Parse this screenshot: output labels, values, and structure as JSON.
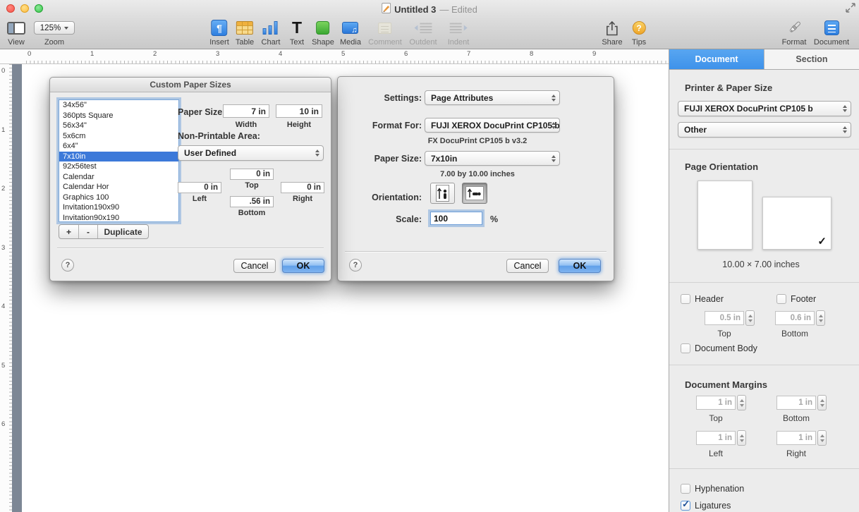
{
  "icons": {
    "check": "✓",
    "question": "?",
    "pilcrow": "¶",
    "music": "♫",
    "text_t": "T"
  },
  "window": {
    "title": "Untitled 3",
    "edited": "— Edited"
  },
  "toolbar": {
    "view": {
      "label": "View"
    },
    "zoom": {
      "label": "Zoom",
      "value": "125%"
    },
    "insert": {
      "label": "Insert"
    },
    "table": {
      "label": "Table"
    },
    "chart": {
      "label": "Chart"
    },
    "text": {
      "label": "Text"
    },
    "shape": {
      "label": "Shape"
    },
    "media": {
      "label": "Media"
    },
    "comment": {
      "label": "Comment"
    },
    "outdent": {
      "label": "Outdent"
    },
    "indent": {
      "label": "Indent"
    },
    "share": {
      "label": "Share"
    },
    "tips": {
      "label": "Tips"
    },
    "format": {
      "label": "Format"
    },
    "document": {
      "label": "Document"
    }
  },
  "ruler": {
    "horizontal": [
      "0",
      "1",
      "2",
      "3",
      "4",
      "5",
      "6",
      "7",
      "8",
      "9"
    ],
    "vertical": [
      "0",
      "1",
      "2",
      "3",
      "4",
      "5",
      "6"
    ]
  },
  "custom_paper_dialog": {
    "title": "Custom Paper Sizes",
    "sizes": [
      "34x56\"",
      "360pts Square",
      "56x34\"",
      "5x6cm",
      "6x4\"",
      "7x10in",
      "92x56test",
      "Calendar",
      "Calendar Hor",
      "Graphics 100",
      "Invitation190x90",
      "Invitation90x190"
    ],
    "selected": "7x10in",
    "paper_size_label": "Paper Size:",
    "width": {
      "value": "7 in",
      "label": "Width"
    },
    "height": {
      "value": "10 in",
      "label": "Height"
    },
    "nonprintable_label": "Non-Printable Area:",
    "nonprintable_value": "User Defined",
    "margin_top": {
      "value": "0 in",
      "label": "Top"
    },
    "margin_left": {
      "value": "0 in",
      "label": "Left"
    },
    "margin_right": {
      "value": "0 in",
      "label": "Right"
    },
    "margin_bottom": {
      "value": ".56 in",
      "label": "Bottom"
    },
    "add_label": "+",
    "remove_label": "-",
    "duplicate_label": "Duplicate",
    "help_label": "?",
    "cancel_label": "Cancel",
    "ok_label": "OK"
  },
  "page_setup_dialog": {
    "settings_label": "Settings:",
    "settings_value": "Page Attributes",
    "format_label": "Format For:",
    "format_value": "FUJI XEROX DocuPrint CP105 b",
    "format_sub": "FX DocuPrint CP105 b v3.2",
    "paper_label": "Paper Size:",
    "paper_value": "7x10in",
    "paper_sub": "7.00 by 10.00 inches",
    "orientation_label": "Orientation:",
    "scale_label": "Scale:",
    "scale_value": "100",
    "scale_unit": "%",
    "help_label": "?",
    "cancel_label": "Cancel",
    "ok_label": "OK"
  },
  "sidebar": {
    "tabs": [
      {
        "label": "Document"
      },
      {
        "label": "Section"
      }
    ],
    "printer": {
      "heading": "Printer & Paper Size",
      "printer_value": "FUJI XEROX DocuPrint CP105 b",
      "paper_value": "Other"
    },
    "orientation": {
      "heading": "Page Orientation",
      "size_text": "10.00 × 7.00 inches"
    },
    "header_footer": {
      "header_label": "Header",
      "footer_label": "Footer",
      "header_field": {
        "value": "0.5 in",
        "label": "Top"
      },
      "footer_field": {
        "value": "0.6 in",
        "label": "Bottom"
      },
      "document_body_label": "Document Body"
    },
    "margins": {
      "heading": "Document Margins",
      "top": {
        "value": "1 in",
        "label": "Top"
      },
      "bottom": {
        "value": "1 in",
        "label": "Bottom"
      },
      "left": {
        "value": "1 in",
        "label": "Left"
      },
      "right": {
        "value": "1 in",
        "label": "Right"
      }
    },
    "typography": {
      "hyphenation_label": "Hyphenation",
      "ligatures_label": "Ligatures"
    }
  }
}
